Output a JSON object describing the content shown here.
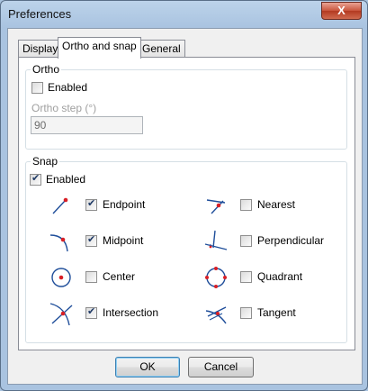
{
  "window": {
    "title": "Preferences",
    "close_symbol": "X"
  },
  "tabs": [
    {
      "label": "Display",
      "active": false
    },
    {
      "label": "Ortho and snap",
      "active": true
    },
    {
      "label": "General",
      "active": false
    }
  ],
  "ortho": {
    "group_label": "Ortho",
    "enabled_label": "Enabled",
    "enabled": false,
    "step_label": "Ortho step (°)",
    "step_value": "90"
  },
  "snap": {
    "group_label": "Snap",
    "enabled_label": "Enabled",
    "enabled": true,
    "modes": [
      {
        "label": "Endpoint",
        "checked": true,
        "icon": "endpoint-icon"
      },
      {
        "label": "Nearest",
        "checked": false,
        "icon": "nearest-icon"
      },
      {
        "label": "Midpoint",
        "checked": true,
        "icon": "midpoint-icon"
      },
      {
        "label": "Perpendicular",
        "checked": false,
        "icon": "perpendicular-icon"
      },
      {
        "label": "Center",
        "checked": false,
        "icon": "center-icon"
      },
      {
        "label": "Quadrant",
        "checked": false,
        "icon": "quadrant-icon"
      },
      {
        "label": "Intersection",
        "checked": true,
        "icon": "intersection-icon"
      },
      {
        "label": "Tangent",
        "checked": false,
        "icon": "tangent-icon"
      }
    ]
  },
  "buttons": {
    "ok": "OK",
    "cancel": "Cancel"
  },
  "colors": {
    "icon_stroke": "#1f4e9a",
    "icon_point": "#d81f26"
  }
}
